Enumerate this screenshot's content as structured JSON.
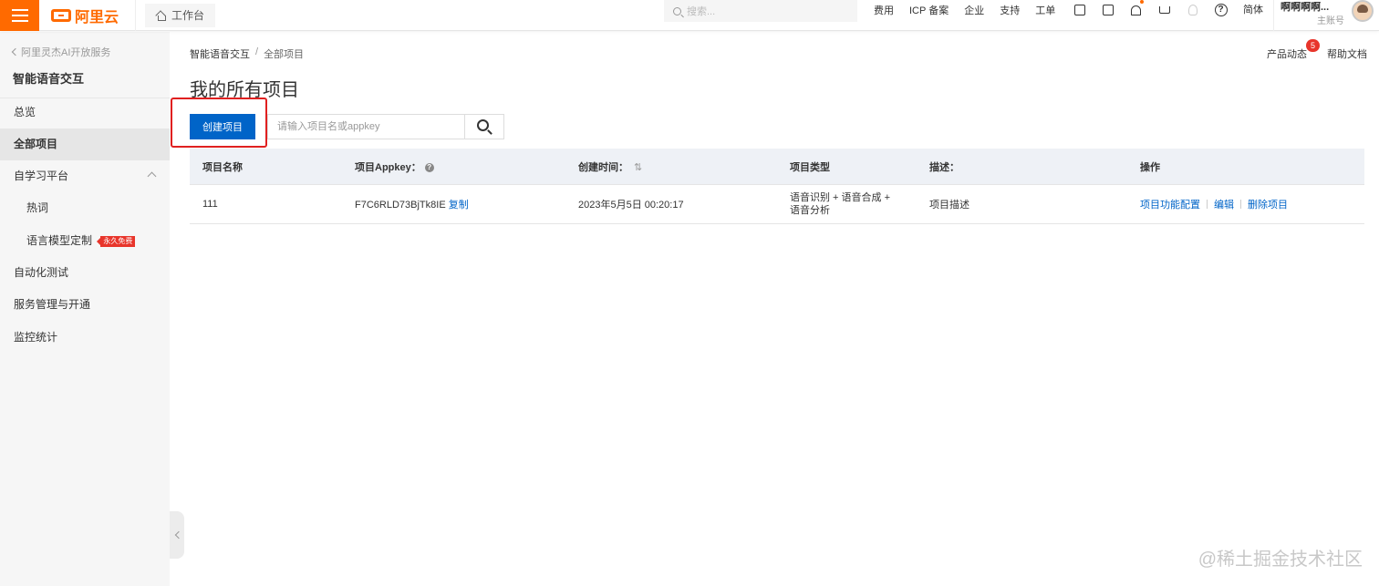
{
  "topbar": {
    "brand": "阿里云",
    "workbench": "工作台",
    "search_placeholder": "搜索...",
    "links": [
      "费用",
      "ICP 备案",
      "企业",
      "支持",
      "工单"
    ],
    "language": "简体",
    "account_name": "啊啊啊啊...",
    "account_role": "主账号",
    "accent_color": "#ff6a00"
  },
  "sidebar": {
    "back_label": "阿里灵杰AI开放服务",
    "product_title": "智能语音交互",
    "items": [
      {
        "label": "总览"
      },
      {
        "label": "全部项目"
      },
      {
        "label": "自学习平台"
      },
      {
        "label": "热词"
      },
      {
        "label": "语言模型定制"
      },
      {
        "label": "自动化测试"
      },
      {
        "label": "服务管理与开通"
      },
      {
        "label": "监控统计"
      }
    ],
    "free_badge": "永久免费"
  },
  "breadcrumb": {
    "root": "智能语音交互",
    "sep": "/",
    "current": "全部项目"
  },
  "page_title": "我的所有项目",
  "header_right": {
    "news": "产品动态",
    "news_count": "5",
    "help": "帮助文档"
  },
  "toolbar": {
    "create_label": "创建项目",
    "search_placeholder": "请输入项目名或appkey"
  },
  "table": {
    "headers": [
      "项目名称",
      "项目Appkey",
      "创建时间",
      "项目类型",
      "描述",
      "操作"
    ],
    "rows": [
      {
        "name": "111",
        "appkey": "F7C6RLD73BjTk8IE",
        "copy": "复制",
        "created": "2023年5月5日 00:20:17",
        "type": "语音识别 + 语音合成 + 语音分析",
        "desc": "项目描述",
        "ops": [
          "项目功能配置",
          "编辑",
          "删除项目"
        ]
      }
    ]
  },
  "watermark": "@稀土掘金技术社区",
  "primary_color": "#0064c8"
}
